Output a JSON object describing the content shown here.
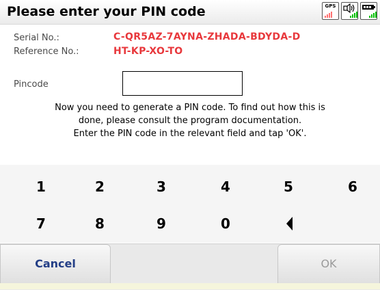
{
  "title": "Please enter your PIN code",
  "status_icons": {
    "gps_label": "GPS",
    "sound_icon": "speaker-icon",
    "battery_icon": "battery-icon"
  },
  "serial_label": "Serial No.:",
  "serial_value": "C-QR5AZ-7AYNA-ZHADA-BDYDA-D",
  "reference_label": "Reference No.:",
  "reference_value": "HT-KP-XO-TO",
  "pincode_label": "Pincode",
  "pincode_value": "",
  "info_lines": [
    "Now you need to generate a PIN code. To find out how this is",
    "done, please consult the program documentation.",
    "Enter the PIN code in the relevant field and tap 'OK'."
  ],
  "keys_row1": [
    "1",
    "2",
    "3",
    "4",
    "5",
    "6"
  ],
  "keys_row2": [
    "7",
    "8",
    "9",
    "0"
  ],
  "backspace_icon": "backspace-arrow-icon",
  "cancel_label": "Cancel",
  "ok_label": "OK",
  "accent_color": "#e8383c"
}
